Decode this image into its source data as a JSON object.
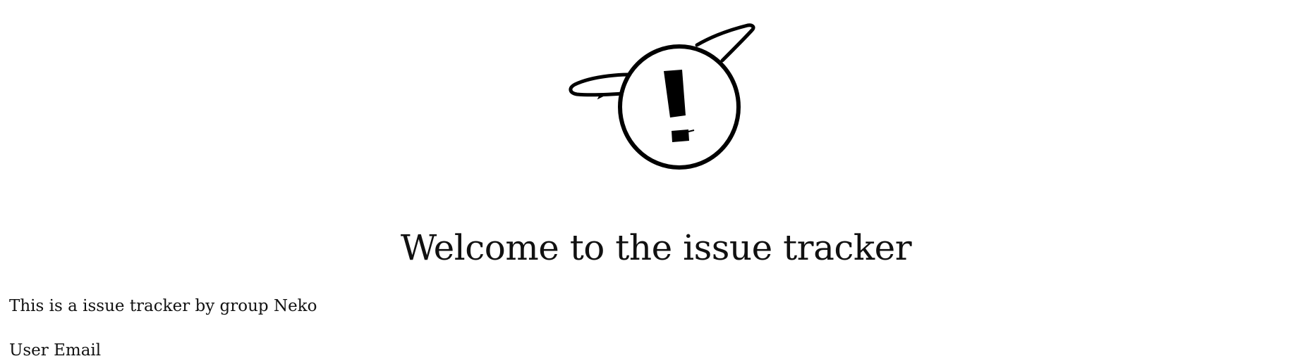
{
  "logo": {
    "icon": "exclamation-mark-with-ears-icon",
    "color": "#000000"
  },
  "header": {
    "title": "Welcome to the issue tracker"
  },
  "main": {
    "intro": "This is a issue tracker by group Neko",
    "email_label": "User Email"
  }
}
